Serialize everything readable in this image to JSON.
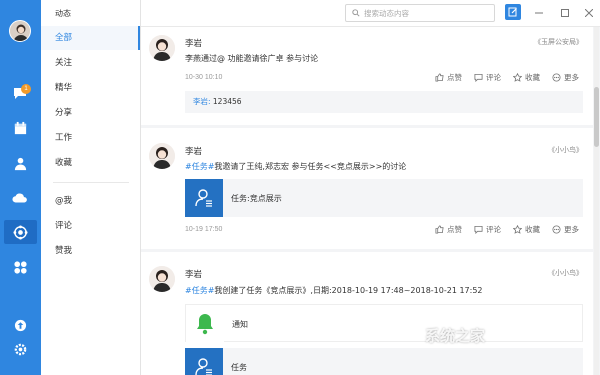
{
  "app": {
    "nav_title": "动态"
  },
  "rail": {
    "badge": "1",
    "icons": [
      "chat-bubble-icon",
      "calendar-icon",
      "contacts-icon",
      "cloud-icon",
      "workspace-icon",
      "apps-icon",
      "upload-icon",
      "settings-icon"
    ]
  },
  "nav": {
    "items": [
      "全部",
      "关注",
      "精华",
      "分享",
      "工作",
      "收藏",
      "@我",
      "评论",
      "赞我"
    ],
    "active": "全部"
  },
  "topbar": {
    "search_placeholder": "搜索动态内容"
  },
  "posts": [
    {
      "author": "李岩",
      "source": "《玉屏公安局》",
      "text_prefix": "李燕通过@ 功能邀请徐广卓 参与讨论",
      "time": "10-30 10:10",
      "actions": [
        "点赞",
        "评论",
        "收藏",
        "更多"
      ],
      "comment": {
        "name": "李岩:",
        "text": " 123456"
      }
    },
    {
      "author": "李岩",
      "source": "《小小鸟》",
      "topic": "#任务#",
      "text": "我邀请了王纯,郑志宏 参与任务<<竞点展示>>的讨论",
      "card_label": "任务:竞点展示",
      "time": "10-19 17:50",
      "actions": [
        "点赞",
        "评论",
        "收藏",
        "更多"
      ]
    },
    {
      "author": "李岩",
      "source": "《小小鸟》",
      "topic": "#任务#",
      "text": "我创建了任务《竞点展示》,日期:2018-10-19 17:48~2018-10-21 17:52",
      "notice_label": "通知",
      "task_label": "任务"
    }
  ],
  "watermark": "系统之家",
  "colors": {
    "accent": "#2f86e0",
    "rail": "#2f86e0",
    "badge": "#f39b2a",
    "notice": "#3db84e"
  }
}
